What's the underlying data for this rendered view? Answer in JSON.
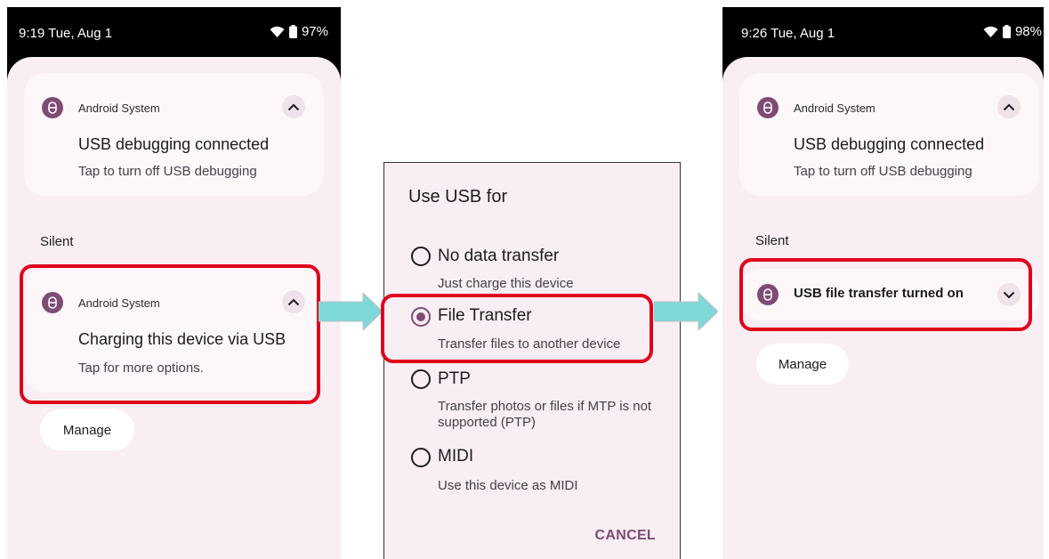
{
  "left_screen": {
    "status_time": "9:19 Tue, Aug 1",
    "battery": "97%",
    "usb_notification": {
      "app": "Android System",
      "title": "USB debugging connected",
      "text": "Tap to turn off USB debugging"
    },
    "section_label": "Silent",
    "charging_notification": {
      "app": "Android System",
      "title": "Charging this device via USB",
      "text": "Tap for more options."
    },
    "manage_label": "Manage"
  },
  "dialog": {
    "title": "Use USB for",
    "options": [
      {
        "label": "No data transfer",
        "desc": "Just charge this device",
        "selected": false
      },
      {
        "label": "File Transfer",
        "desc": "Transfer files to another device",
        "selected": true
      },
      {
        "label": "PTP",
        "desc_line1": "Transfer photos or files if MTP is not",
        "desc_line2": "supported (PTP)",
        "selected": false
      },
      {
        "label": "MIDI",
        "desc": "Use this device as MIDI",
        "selected": false
      }
    ],
    "cancel_label": "CANCEL"
  },
  "right_screen": {
    "status_time": "9:26 Tue, Aug 1",
    "battery": "98%",
    "usb_notification": {
      "app": "Android System",
      "title": "USB debugging connected",
      "text": "Tap to turn off USB debugging"
    },
    "section_label": "Silent",
    "file_transfer_notification": {
      "title": "USB file transfer turned on"
    },
    "manage_label": "Manage"
  },
  "colors": {
    "accent": "#7e4b74",
    "highlight": "#e0001b",
    "arrow": "#7fd8d8",
    "shade": "#f9eef3"
  }
}
